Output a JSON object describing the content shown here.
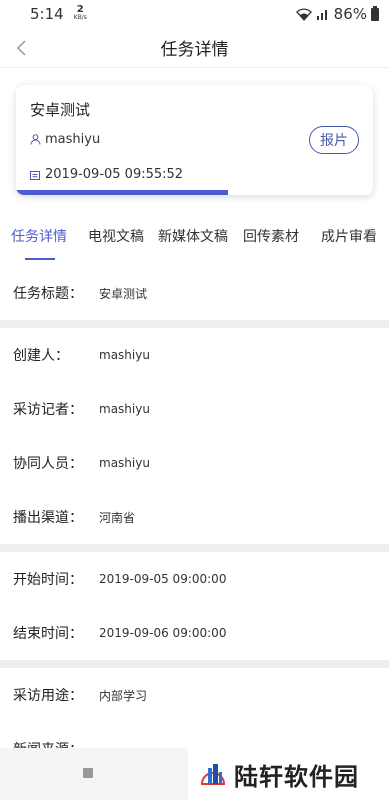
{
  "status_bar": {
    "time": "5:14",
    "speed_value": "2",
    "speed_unit": "KB/s",
    "battery": "86%"
  },
  "nav": {
    "title": "任务详情"
  },
  "card": {
    "title": "安卓测试",
    "creator": "mashiyu",
    "datetime": "2019-09-05 09:55:52",
    "report_button": "报片",
    "progress": 0.595
  },
  "tabs": [
    {
      "label": "任务详情",
      "active": true
    },
    {
      "label": "电视文稿",
      "active": false
    },
    {
      "label": "新媒体文稿",
      "active": false
    },
    {
      "label": "回传素材",
      "active": false
    },
    {
      "label": "成片审看",
      "active": false
    }
  ],
  "details": {
    "task_title": {
      "label": "任务标题：",
      "value": "安卓测试"
    },
    "creator": {
      "label": "创建人：",
      "value": "mashiyu"
    },
    "reporter": {
      "label": "采访记者：",
      "value": "mashiyu"
    },
    "collaborator": {
      "label": "协同人员：",
      "value": "mashiyu"
    },
    "channel": {
      "label": "播出渠道：",
      "value": "河南省"
    },
    "start_time": {
      "label": "开始时间：",
      "value": "2019-09-05 09:00:00"
    },
    "end_time": {
      "label": "结束时间：",
      "value": "2019-09-06 09:00:00"
    },
    "purpose": {
      "label": "采访用途：",
      "value": "内部学习"
    },
    "news_source": {
      "label": "新闻来源：",
      "value": ""
    }
  },
  "watermark": {
    "text": "陆轩软件园"
  },
  "colors": {
    "accent": "#4a5bd4",
    "button_border": "#4a5aa8",
    "separator": "#eeeeee"
  }
}
